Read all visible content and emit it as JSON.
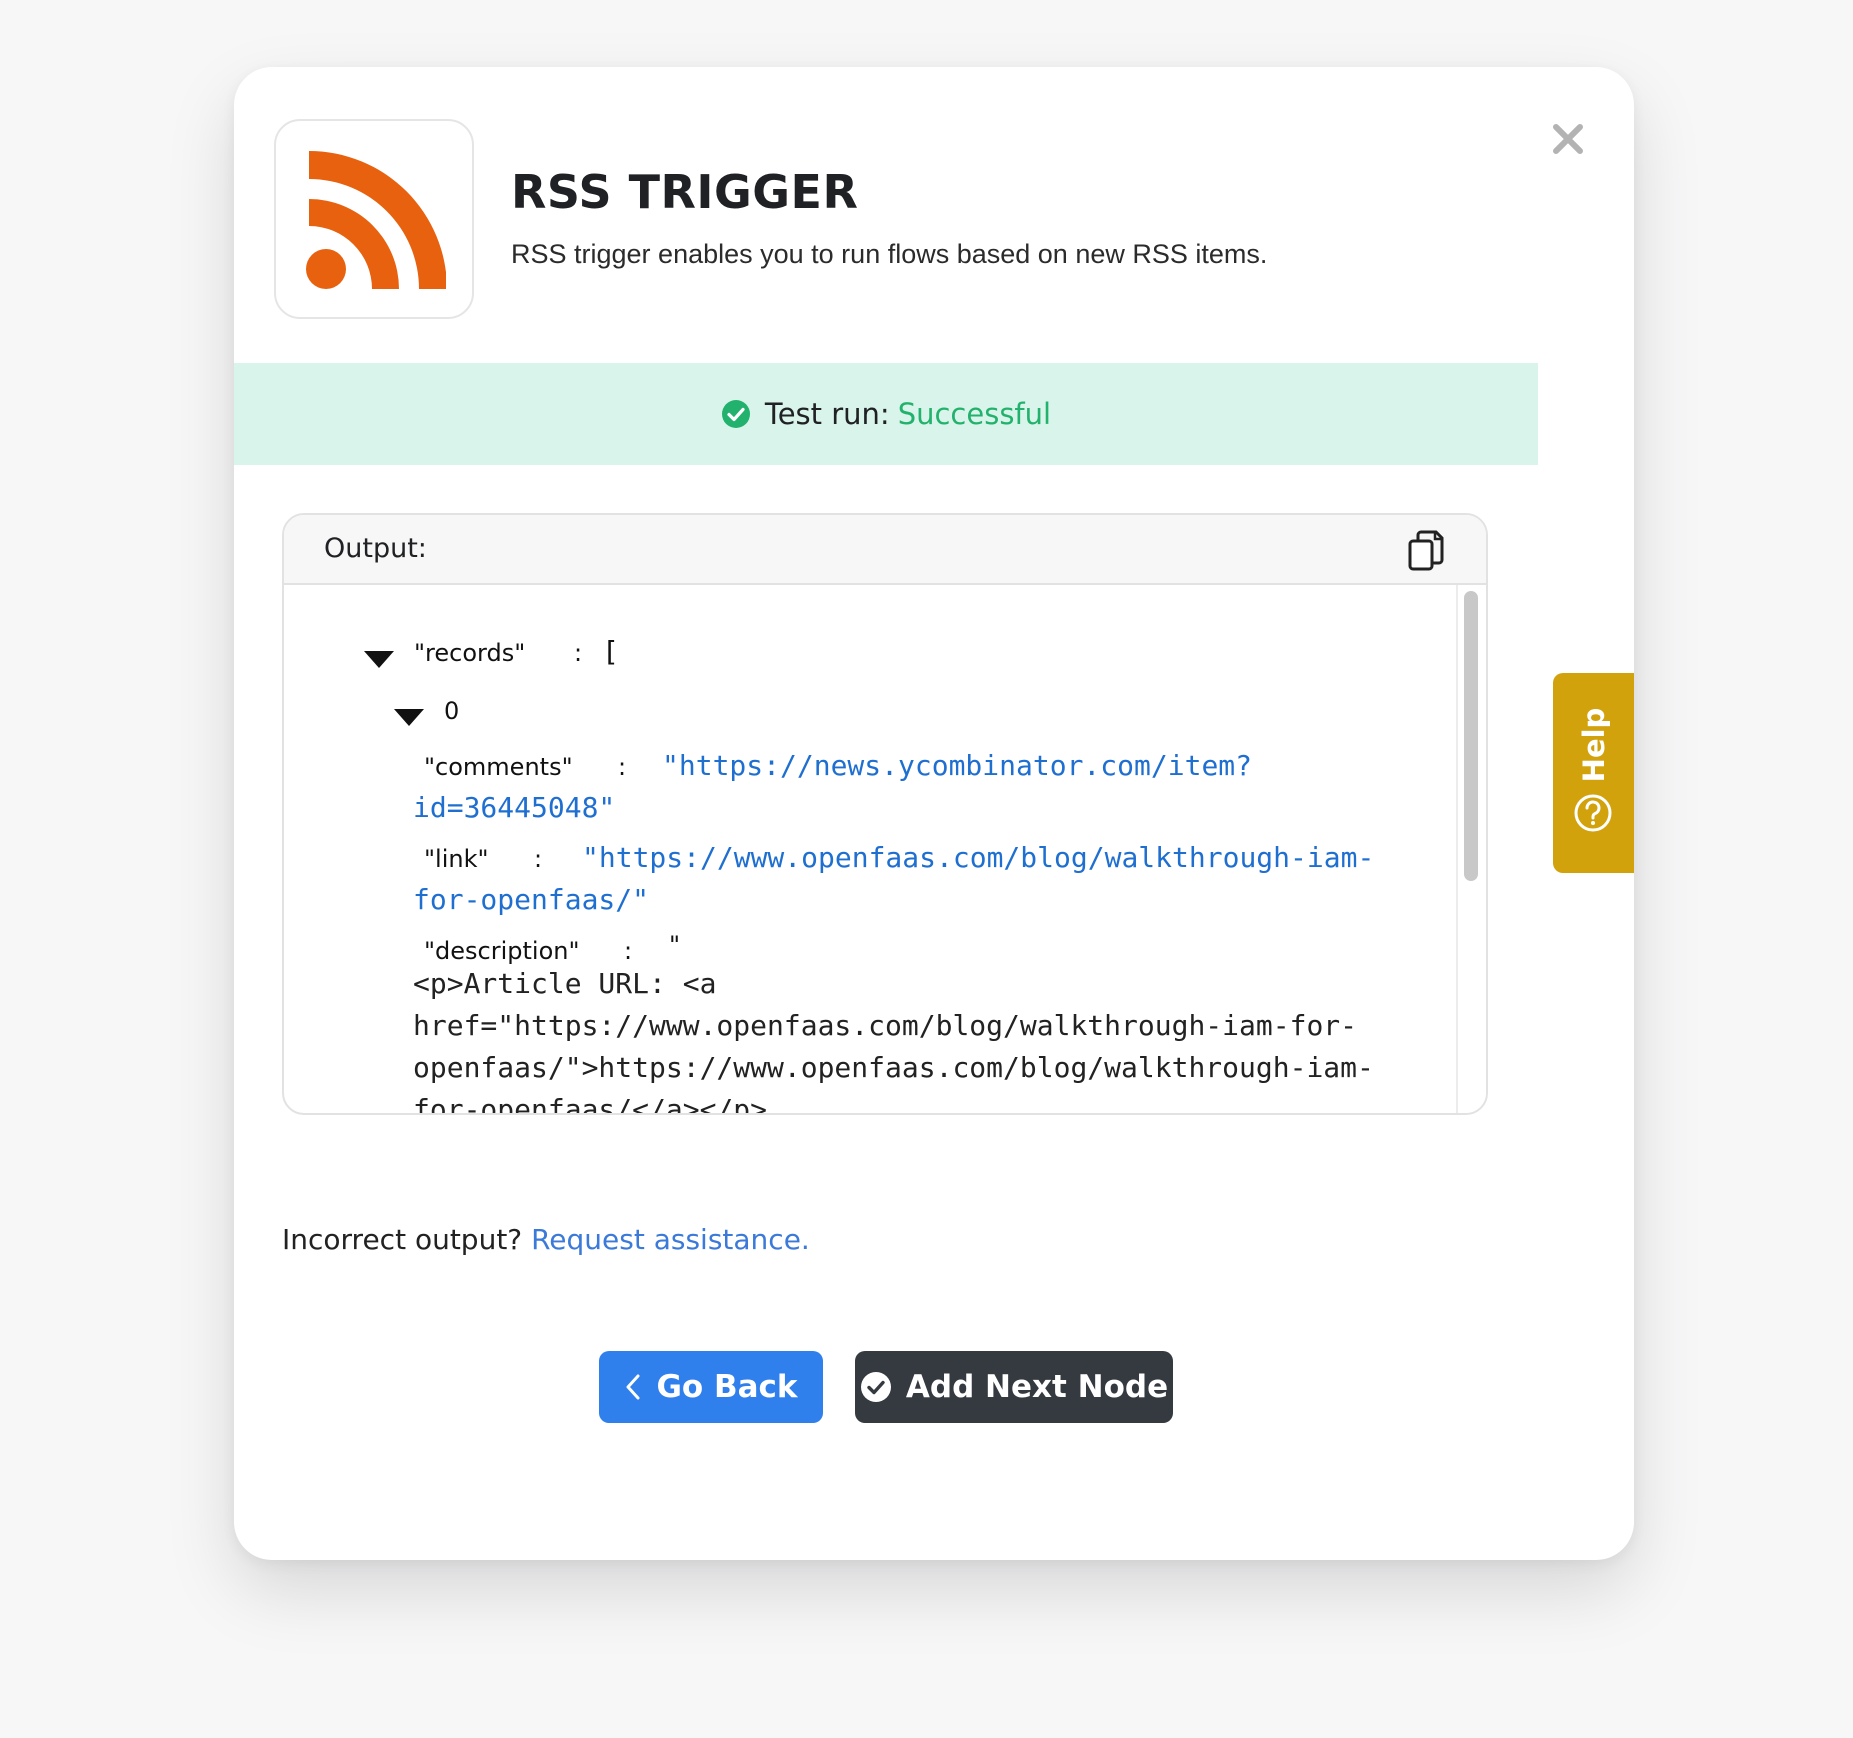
{
  "header": {
    "title": "RSS TRIGGER",
    "description": "RSS trigger enables you to run flows based on new RSS items.",
    "logo_icon": "rss-icon",
    "logo_color": "#e8610f"
  },
  "status": {
    "label": "Test run:",
    "value": "Successful",
    "icon": "check-circle-icon",
    "color": "#23b26d"
  },
  "output": {
    "label": "Output:",
    "copy_icon": "copy-icon",
    "records_key": "\"records\"",
    "records_colon": ":",
    "records_open": "[",
    "index_0": "0",
    "comments_key": "\"comments\"",
    "comments_colon": ":",
    "comments_value_line1": "\"https://news.ycombinator.com/item?",
    "comments_value_line2": "id=36445048\"",
    "link_key": "\"link\"",
    "link_colon": ":",
    "link_value_line1": "\"https://www.openfaas.com/blog/walkthrough-iam-",
    "link_value_line2": "for-openfaas/\"",
    "description_key": "\"description\"",
    "description_colon": ":",
    "description_open": "\"",
    "description_text": "<p>Article URL: <a\nhref=\"https://www.openfaas.com/blog/walkthrough-iam-for-\nopenfaas/\">https://www.openfaas.com/blog/walkthrough-iam-\nfor-openfaas/</a></p>\n<p>Comments URL: <a"
  },
  "footer": {
    "incorrect_text": "Incorrect output?",
    "assist_link": "Request assistance."
  },
  "buttons": {
    "back_label": "Go Back",
    "next_label": "Add Next Node"
  },
  "help": {
    "label": "Help"
  }
}
